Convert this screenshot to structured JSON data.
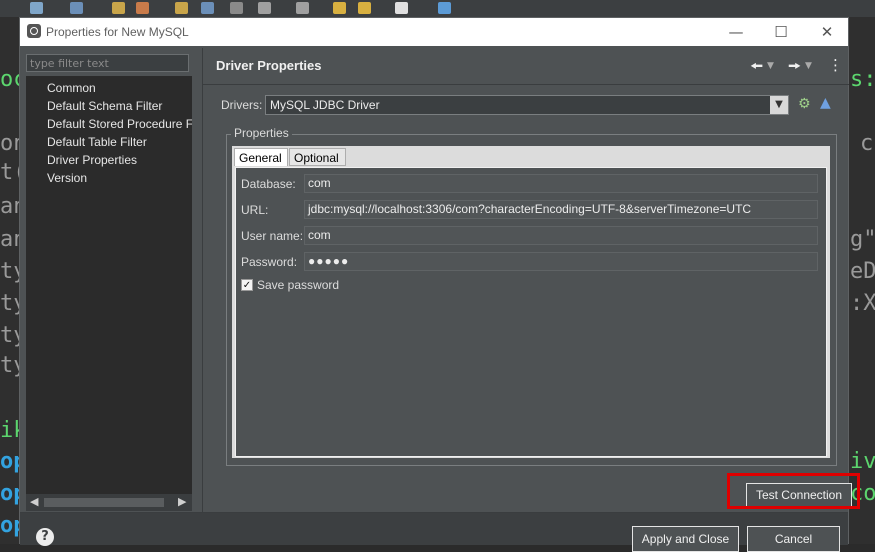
{
  "dialog": {
    "title": "Properties for New MySQL",
    "filter_placeholder": "type filter text",
    "nav_items": [
      "Common",
      "Default Schema Filter",
      "Default Stored Procedure F",
      "Default Table Filter",
      "Driver Properties",
      "Version"
    ],
    "page_title": "Driver Properties",
    "drivers_label": "Drivers:",
    "drivers_value": "MySQL JDBC Driver",
    "properties_label": "Properties",
    "tabs": [
      "General",
      "Optional"
    ],
    "fields": {
      "database_label": "Database:",
      "database_value": "com",
      "url_label": "URL:",
      "url_value": "jdbc:mysql://localhost:3306/com?characterEncoding=UTF-8&serverTimezone=UTC",
      "username_label": "User name:",
      "username_value": "com",
      "password_label": "Password:",
      "password_value": "●●●●●"
    },
    "save_password_label": "Save password",
    "save_password_checked": true,
    "test_connection_label": "Test Connection",
    "apply_close_label": "Apply and Close",
    "cancel_label": "Cancel"
  },
  "colors": {
    "dialog_bg": "#4e5254",
    "nav_bg": "#2b2b2b",
    "highlight": "#e00000",
    "titlebar_bg": "#ffffff"
  }
}
